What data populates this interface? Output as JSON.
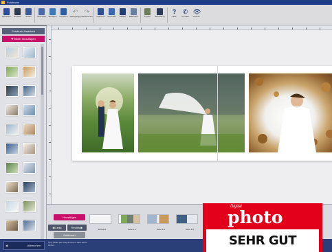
{
  "window": {
    "title": "Fotoframe"
  },
  "toolbar": {
    "items": [
      {
        "label": "Speichern",
        "icon": "save-icon"
      },
      {
        "label": "Drucken",
        "icon": "print-icon"
      },
      {
        "label": "Seiten",
        "icon": "pages-icon"
      },
      {
        "label": "Übersicht",
        "icon": "overview-icon"
      },
      {
        "label": "Einfügen",
        "icon": "paste-icon"
      },
      {
        "label": "Kopieren",
        "icon": "copy-icon"
      },
      {
        "label": "Rückgängig",
        "icon": "undo-icon"
      },
      {
        "label": "Wiederholen",
        "icon": "redo-icon"
      },
      {
        "label": "Optionen",
        "icon": "options-icon"
      },
      {
        "label": "Vorschau",
        "icon": "preview-icon"
      },
      {
        "label": "Effekte",
        "icon": "effects-icon"
      },
      {
        "label": "Bildraster",
        "icon": "grid-icon"
      },
      {
        "label": "Layout",
        "icon": "layout-icon"
      },
      {
        "label": "Bestellung",
        "icon": "order-icon"
      },
      {
        "label": "Hilfe",
        "icon": "help-icon"
      },
      {
        "label": "Kontakt",
        "icon": "contact-icon"
      },
      {
        "label": "Ansicht",
        "icon": "view-icon"
      }
    ]
  },
  "sidebar": {
    "header": "Fotobuch Assistent",
    "add_more": "Bilder hinzufügen"
  },
  "filmstrip": {
    "add_button": "Hinzufügen",
    "links_button": "Links",
    "rechts_button": "Rechts",
    "remove_button": "Entfernen",
    "labels": [
      "Einband",
      "Seite 1-2",
      "Seite 3-4",
      "Seite 5-6"
    ]
  },
  "statusbar": {
    "back_button": "Abbrechen",
    "hint": "Tipp: Bilder per Drag & Drop in das Layout ziehen."
  },
  "badge": {
    "small": "Digital",
    "big": "photo",
    "verdict": "SEHR GUT"
  },
  "colors": {
    "title_bar": "#1e3d86",
    "accent": "#c8106a",
    "badge_red": "#e2001a"
  }
}
